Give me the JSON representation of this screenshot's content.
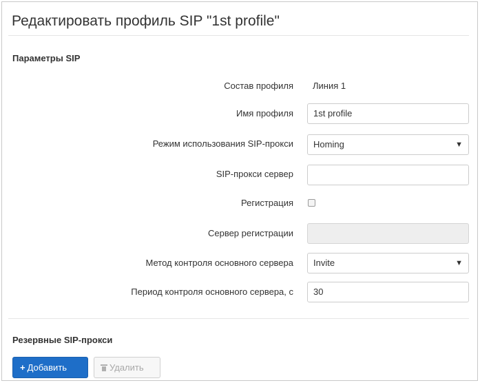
{
  "page": {
    "title": "Редактировать профиль SIP \"1st profile\""
  },
  "sip_params": {
    "heading": "Параметры SIP",
    "profile_composition": {
      "label": "Состав профиля",
      "value": "Линия 1"
    },
    "profile_name": {
      "label": "Имя профиля",
      "value": "1st profile"
    },
    "proxy_mode": {
      "label": "Режим использования SIP-прокси",
      "value": "Homing"
    },
    "proxy_server": {
      "label": "SIP-прокси сервер",
      "value": ""
    },
    "registration": {
      "label": "Регистрация",
      "checked": false
    },
    "registration_server": {
      "label": "Сервер регистрации",
      "value": ""
    },
    "main_server_check_method": {
      "label": "Метод контроля основного сервера",
      "value": "Invite"
    },
    "main_server_check_period": {
      "label": "Период контроля основного сервера, с",
      "value": "30"
    }
  },
  "backup_proxy": {
    "heading": "Резервные SIP-прокси",
    "add_button": "Добавить",
    "delete_button": "Удалить"
  },
  "icons": {
    "select_arrow": "▼",
    "add": "+"
  },
  "colors": {
    "primary_button": "#1e6ec8",
    "disabled_field": "#eeeeee"
  }
}
